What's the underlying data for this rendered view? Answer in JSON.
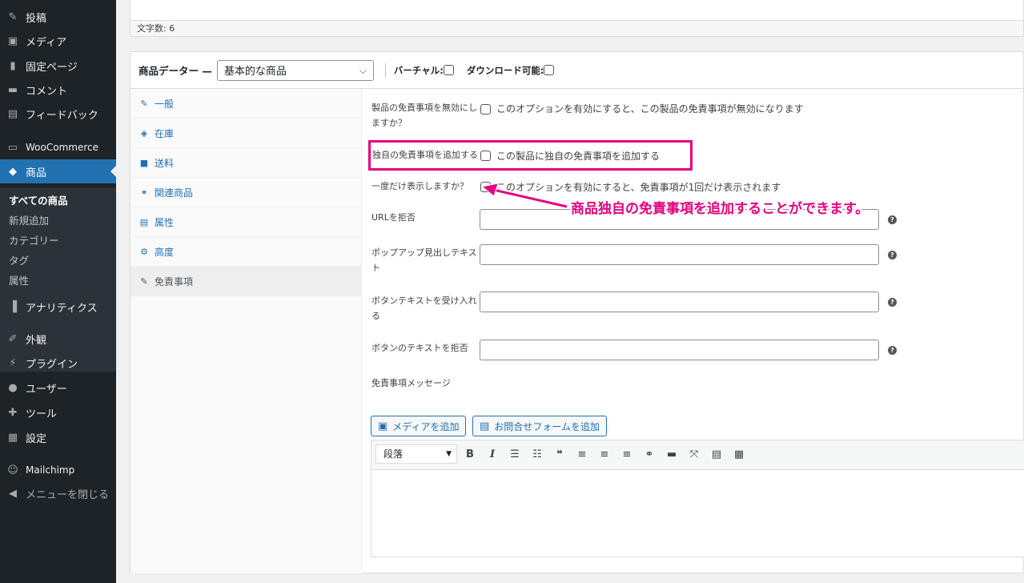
{
  "sidebar": {
    "items": [
      {
        "icon": "pin-icon",
        "glyph": "✎",
        "label": "投稿"
      },
      {
        "icon": "media-icon",
        "glyph": "▣",
        "label": "メディア"
      },
      {
        "icon": "page-icon",
        "glyph": "▮",
        "label": "固定ページ"
      },
      {
        "icon": "comment-icon",
        "glyph": "▬",
        "label": "コメント"
      },
      {
        "icon": "feedback-icon",
        "glyph": "▤",
        "label": "フィードバック"
      },
      {
        "icon": "woo-icon",
        "glyph": "▭",
        "label": "WooCommerce"
      },
      {
        "icon": "product-icon",
        "glyph": "◆",
        "label": "商品"
      },
      {
        "icon": "analytics-icon",
        "glyph": "▐",
        "label": "アナリティクス"
      },
      {
        "icon": "appearance-icon",
        "glyph": "✐",
        "label": "外観"
      },
      {
        "icon": "plugin-icon",
        "glyph": "⚡",
        "label": "プラグイン"
      },
      {
        "icon": "user-icon",
        "glyph": "●",
        "label": "ユーザー"
      },
      {
        "icon": "tool-icon",
        "glyph": "✚",
        "label": "ツール"
      },
      {
        "icon": "settings-icon",
        "glyph": "▦",
        "label": "設定"
      },
      {
        "icon": "mailchimp-icon",
        "glyph": "☺",
        "label": "Mailchimp"
      },
      {
        "icon": "collapse-icon",
        "glyph": "◀",
        "label": "メニューを閉じる"
      }
    ],
    "sub_items": [
      "すべての商品",
      "新規追加",
      "カテゴリー",
      "タグ",
      "属性"
    ]
  },
  "editor": {
    "word_count": "文字数: 6"
  },
  "product_data": {
    "title": "商品データー —",
    "type_selected": "基本的な商品",
    "virtual_label": "バーチャル:",
    "downloadable_label": "ダウンロード可能:",
    "tabs": [
      {
        "icon": "wrench-icon",
        "glyph": "🔧",
        "label": "一般"
      },
      {
        "icon": "inventory-icon",
        "glyph": "◈",
        "label": "在庫"
      },
      {
        "icon": "shipping-icon",
        "glyph": "■",
        "label": "送料"
      },
      {
        "icon": "link-icon",
        "glyph": "⚭",
        "label": "関連商品"
      },
      {
        "icon": "attributes-icon",
        "glyph": "▤",
        "label": "属性"
      },
      {
        "icon": "gear-icon",
        "glyph": "⚙",
        "label": "高度"
      },
      {
        "icon": "wrench-icon",
        "glyph": "🔧",
        "label": "免責事項"
      }
    ]
  },
  "options": {
    "disable_label_1": "製品の免責事項を無効にし",
    "disable_label_2": "ますか？",
    "disable_desc": "このオプションを有効にすると、この製品の免責事項が無効になります",
    "custom_label": "独自の免責事項を追加する",
    "custom_desc": "この製品に独自の免責事項を追加する",
    "once_label": "一度だけ表示しますか？",
    "once_desc": "このオプションを有効にすると、免責事項が1回だけ表示されます",
    "reject_url_label": "URLを拒否",
    "popup_label_1": "ポップアップ見出しテキス",
    "popup_label_2": "ト",
    "accept_label_1": "ボタンテキストを受け入れ",
    "accept_label_2": "る",
    "reject_btn_label": "ボタンのテキストを拒否",
    "message_label": "免責事項メッセージ",
    "help_glyph": "?"
  },
  "annotation": {
    "text": "商品独自の免責事項を追加することができます。",
    "color": "#e4007f"
  },
  "media_buttons": {
    "add_media": "メディアを追加",
    "add_form": "お問合せフォームを追加"
  },
  "toolbar": {
    "format_select": "段落",
    "buttons": [
      {
        "name": "bold-button",
        "glyph": "B"
      },
      {
        "name": "italic-button",
        "glyph": "I"
      },
      {
        "name": "bullet-list-button",
        "glyph": "☰"
      },
      {
        "name": "numbered-list-button",
        "glyph": "☷"
      },
      {
        "name": "quote-button",
        "glyph": "❝"
      },
      {
        "name": "align-left-button",
        "glyph": "≡"
      },
      {
        "name": "align-center-button",
        "glyph": "≡"
      },
      {
        "name": "align-right-button",
        "glyph": "≡"
      },
      {
        "name": "link-button",
        "glyph": "⚭"
      },
      {
        "name": "read-more-button",
        "glyph": "▬"
      },
      {
        "name": "fullscreen-button",
        "glyph": "⤧"
      },
      {
        "name": "form-button",
        "glyph": "▤"
      },
      {
        "name": "kitchen-sink-button",
        "glyph": "▦"
      }
    ]
  }
}
